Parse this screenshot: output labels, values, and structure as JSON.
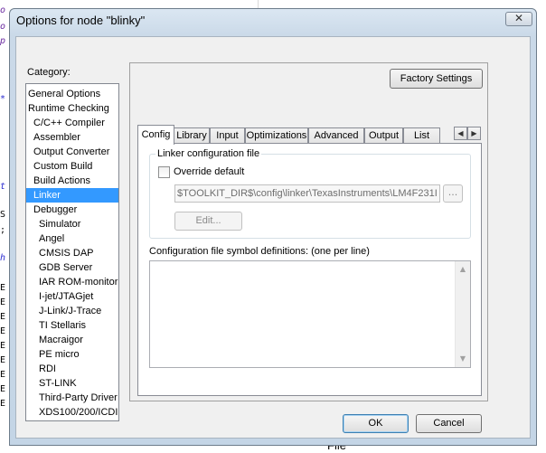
{
  "dialog": {
    "title": "Options for node \"blinky\"",
    "close_glyph": "✕",
    "category_label": "Category:",
    "categories": [
      {
        "label": "General Options",
        "indent": 0
      },
      {
        "label": "Runtime Checking",
        "indent": 0
      },
      {
        "label": "C/C++ Compiler",
        "indent": 1
      },
      {
        "label": "Assembler",
        "indent": 1
      },
      {
        "label": "Output Converter",
        "indent": 1
      },
      {
        "label": "Custom Build",
        "indent": 1
      },
      {
        "label": "Build Actions",
        "indent": 1
      },
      {
        "label": "Linker",
        "indent": 1,
        "selected": true
      },
      {
        "label": "Debugger",
        "indent": 1
      },
      {
        "label": "Simulator",
        "indent": 2
      },
      {
        "label": "Angel",
        "indent": 2
      },
      {
        "label": "CMSIS DAP",
        "indent": 2
      },
      {
        "label": "GDB Server",
        "indent": 2
      },
      {
        "label": "IAR ROM-monitor",
        "indent": 2
      },
      {
        "label": "I-jet/JTAGjet",
        "indent": 2
      },
      {
        "label": "J-Link/J-Trace",
        "indent": 2
      },
      {
        "label": "TI Stellaris",
        "indent": 2
      },
      {
        "label": "Macraigor",
        "indent": 2
      },
      {
        "label": "PE micro",
        "indent": 2
      },
      {
        "label": "RDI",
        "indent": 2
      },
      {
        "label": "ST-LINK",
        "indent": 2
      },
      {
        "label": "Third-Party Driver",
        "indent": 2
      },
      {
        "label": "XDS100/200/ICDI",
        "indent": 2
      }
    ],
    "factory_settings_label": "Factory Settings",
    "tabs": [
      {
        "label": "Config",
        "active": true
      },
      {
        "label": "Library"
      },
      {
        "label": "Input"
      },
      {
        "label": "Optimizations"
      },
      {
        "label": "Advanced"
      },
      {
        "label": "Output"
      },
      {
        "label": "List"
      }
    ],
    "tab_scroll_left": "◀",
    "tab_scroll_right": "▶",
    "config": {
      "group_title": "Linker configuration file",
      "override_label": "Override default",
      "override_checked": false,
      "config_path": "$TOOLKIT_DIR$\\config\\linker\\TexasInstruments\\LM4F231I",
      "browse_label": "...",
      "edit_label": "Edit...",
      "symbols_label": "Configuration file symbol definitions: (one per line)",
      "symbols_value": ""
    },
    "ok_label": "OK",
    "cancel_label": "Cancel"
  },
  "background": {
    "bottom_text": "File"
  }
}
